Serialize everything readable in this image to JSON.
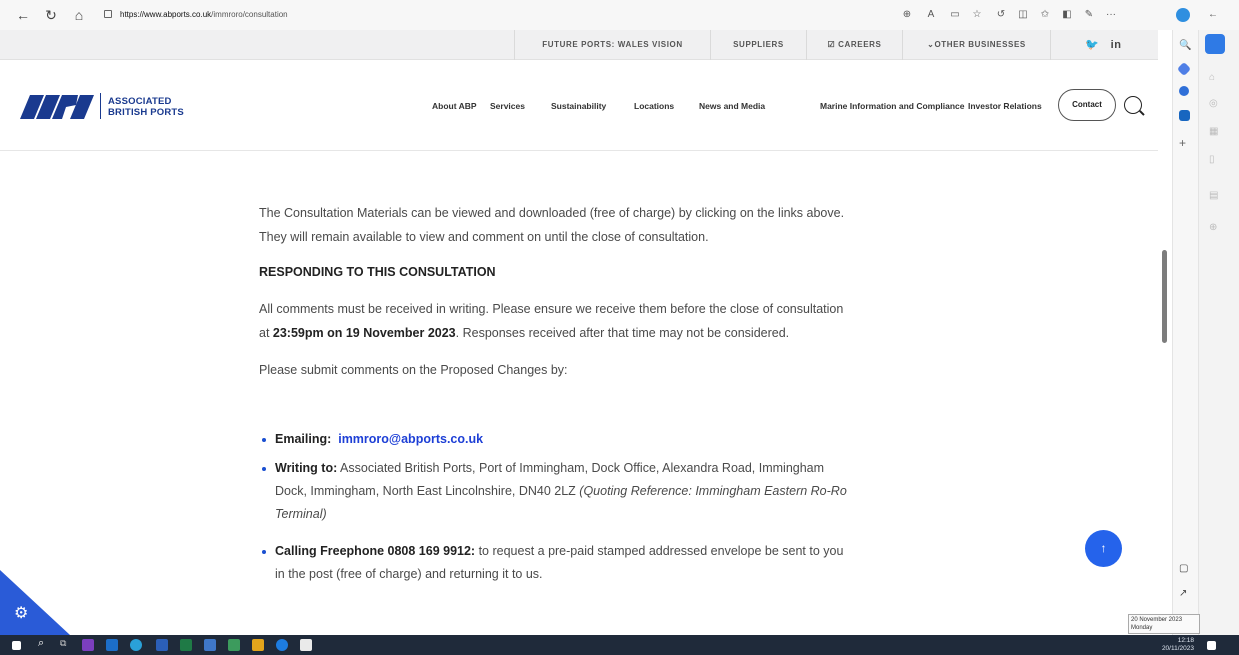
{
  "browser": {
    "url_host": "https://www.abports.co.uk",
    "url_path": "/immroro/consultation"
  },
  "topnav": {
    "items": [
      "FUTURE PORTS: WALES VISION",
      "SUPPLIERS",
      "☑ CAREERS",
      "⌄OTHER BUSINESSES"
    ]
  },
  "logo": {
    "mark": "ABP",
    "line1": "ASSOCIATED",
    "line2": "BRITISH PORTS"
  },
  "mainnav": {
    "items": [
      "About ABP",
      "Services",
      "Sustainability",
      "Locations",
      "News and Media",
      "Marine Information and Compliance",
      "Investor Relations"
    ],
    "contact_label": "Contact"
  },
  "content": {
    "intro_1": "The Consultation Materials can be viewed and downloaded (free of charge) by clicking on the links above.",
    "intro_2": "They will remain available to view and comment on until the close of consultation.",
    "heading": "RESPONDING TO THIS CONSULTATION",
    "respond_1": "All comments must be received in writing. Please ensure we receive them before the close of consultation",
    "respond_2_pre": "at ",
    "respond_2_bold": "23:59pm on 19 November 2023",
    "respond_2_post": ".  Responses received after that time may not be considered.",
    "submit_intro": "Please submit comments on the Proposed Changes by:",
    "email_label": "Emailing:",
    "email_value": "immroro@abports.co.uk",
    "writing_label": "Writing to:",
    "writing_text_1": "Associated British Ports, Port of Immingham, Dock Office, Alexandra Road, Immingham",
    "writing_text_2": "Dock, Immingham, North East Lincolnshire, DN40 2LZ ",
    "writing_ref_1": "(Quoting Reference: Immingham Eastern Ro-Ro",
    "writing_ref_2": "Terminal)",
    "calling_label": "Calling Freephone 0808 169 9912:",
    "calling_text_1": "to request a pre-paid stamped addressed envelope be sent to you",
    "calling_text_2": "in the post (free of charge) and returning it to us."
  },
  "taskbar": {
    "time": "12:18",
    "date": "20/11/2023",
    "tooltip_1": "20 November 2023",
    "tooltip_2": "Monday"
  },
  "colors": {
    "brand_blue": "#2a5bd7",
    "link_blue": "#1d3fd6",
    "taskbar": "#1f2a3a"
  }
}
